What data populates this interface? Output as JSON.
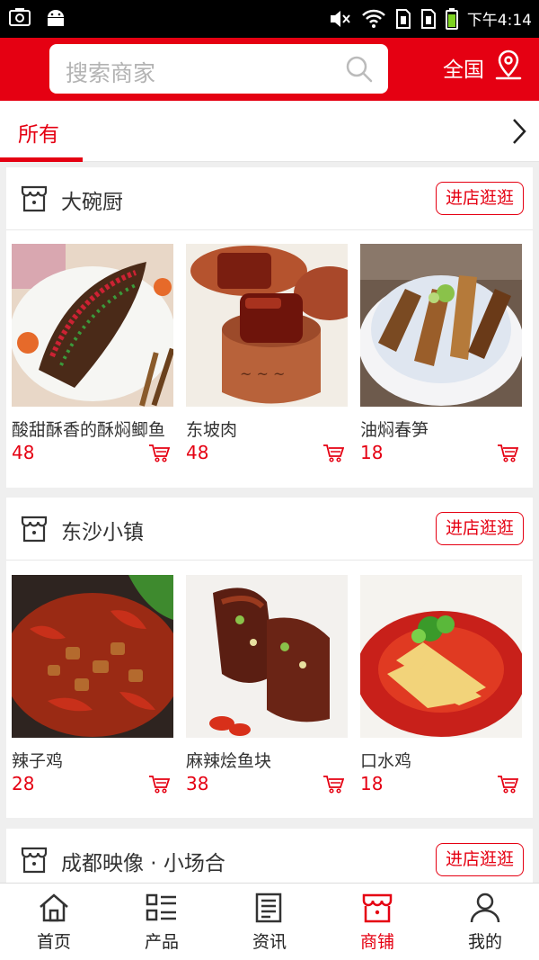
{
  "status_bar": {
    "time": "下午4:14"
  },
  "header": {
    "search_placeholder": "搜索商家",
    "region": "全国"
  },
  "tabs": {
    "active": "所有"
  },
  "shops": [
    {
      "name": "大碗厨",
      "visit_label": "进店逛逛",
      "products": [
        {
          "name": "酸甜酥香的酥焖鲫鱼",
          "price": "48"
        },
        {
          "name": "东坡肉",
          "price": "48"
        },
        {
          "name": "油焖春笋",
          "price": "18"
        }
      ]
    },
    {
      "name": "东沙小镇",
      "visit_label": "进店逛逛",
      "products": [
        {
          "name": "辣子鸡",
          "price": "28"
        },
        {
          "name": "麻辣烩鱼块",
          "price": "38"
        },
        {
          "name": "口水鸡",
          "price": "18"
        }
      ]
    },
    {
      "name": "成都映像 · 小场合",
      "visit_label": "进店逛逛",
      "products": []
    }
  ],
  "bottom_nav": [
    {
      "label": "首页",
      "icon": "home-icon"
    },
    {
      "label": "产品",
      "icon": "list-icon"
    },
    {
      "label": "资讯",
      "icon": "news-icon"
    },
    {
      "label": "商铺",
      "icon": "store-icon"
    },
    {
      "label": "我的",
      "icon": "user-icon"
    }
  ],
  "colors": {
    "brand": "#e50012",
    "background": "#efefef"
  }
}
